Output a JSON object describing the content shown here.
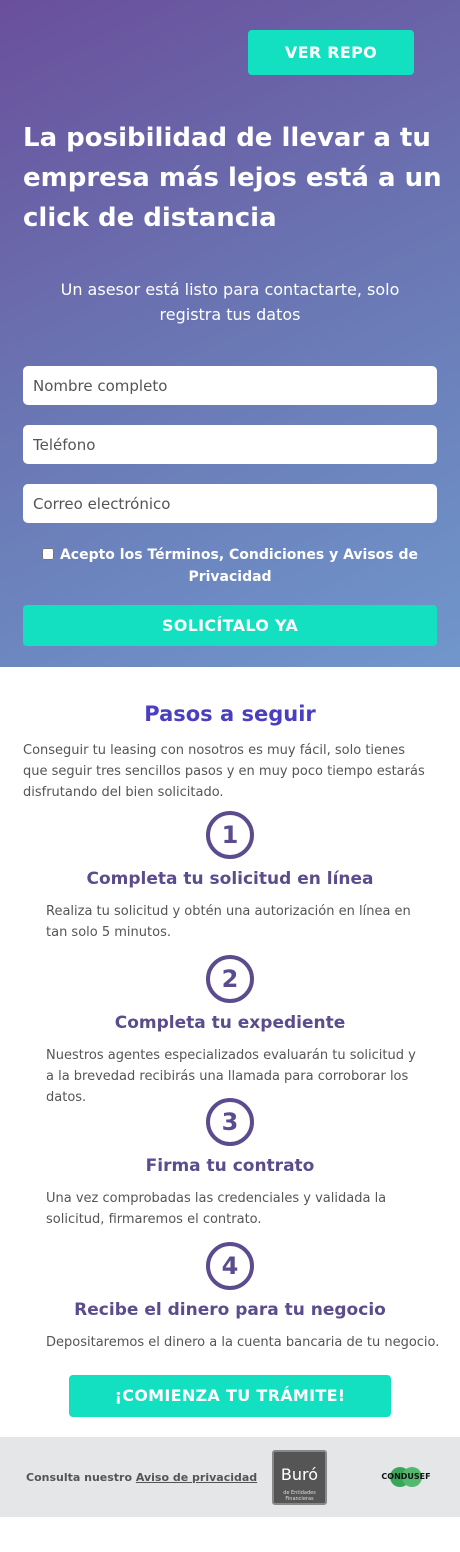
{
  "hero": {
    "repo_button": "VER REPO",
    "title": "La posibilidad de llevar a tu empresa más lejos está a un click de distancia",
    "subtitle": "Un asesor está listo para contactarte, solo registra tus datos"
  },
  "form": {
    "name_placeholder": "Nombre completo",
    "phone_placeholder": "Teléfono",
    "email_placeholder": "Correo electrónico",
    "terms_label": "Acepto los Términos, Condiciones y Avisos de Privacidad",
    "terms_checked": false,
    "submit_label": "SOLICÍTALO YA"
  },
  "steps": {
    "title": "Pasos a seguir",
    "intro": "Conseguir tu leasing con nosotros es muy fácil, solo tienes que seguir tres sencillos pasos y en muy poco tiempo estarás disfrutando del bien solicitado.",
    "items": [
      {
        "number": "1",
        "heading": "Completa tu solicitud en línea",
        "text": "Realiza tu solicitud y obtén una autorización en línea en tan solo 5 minutos."
      },
      {
        "number": "2",
        "heading": "Completa tu expediente",
        "text": "Nuestros agentes especializados evaluarán tu solicitud y a la brevedad recibirás una llamada para corroborar los datos."
      },
      {
        "number": "3",
        "heading": "Firma tu contrato",
        "text": "Una vez comprobadas las credenciales y validada la solicitud, firmaremos el contrato."
      },
      {
        "number": "4",
        "heading": "Recibe el dinero para tu negocio",
        "text": "Depositaremos el dinero a la cuenta bancaria de tu negocio."
      }
    ],
    "cta_label": "¡COMIENZA TU TRÁMITE!"
  },
  "footer": {
    "privacy_prefix": "Consulta nuestro",
    "privacy_link": "Aviso de privacidad",
    "buro_logo_text": "Buró",
    "buro_logo_small": "de Entidades Financieras",
    "condusef_text": "CONDUSEF"
  },
  "colors": {
    "accent": "#13e0c0",
    "heading_purple": "#4a3fc0",
    "step_purple": "#5b4c8e",
    "hero_gradient_start": "#6a4f9c",
    "hero_gradient_end": "#7097cc",
    "footer_bg": "#e4e6e8"
  }
}
